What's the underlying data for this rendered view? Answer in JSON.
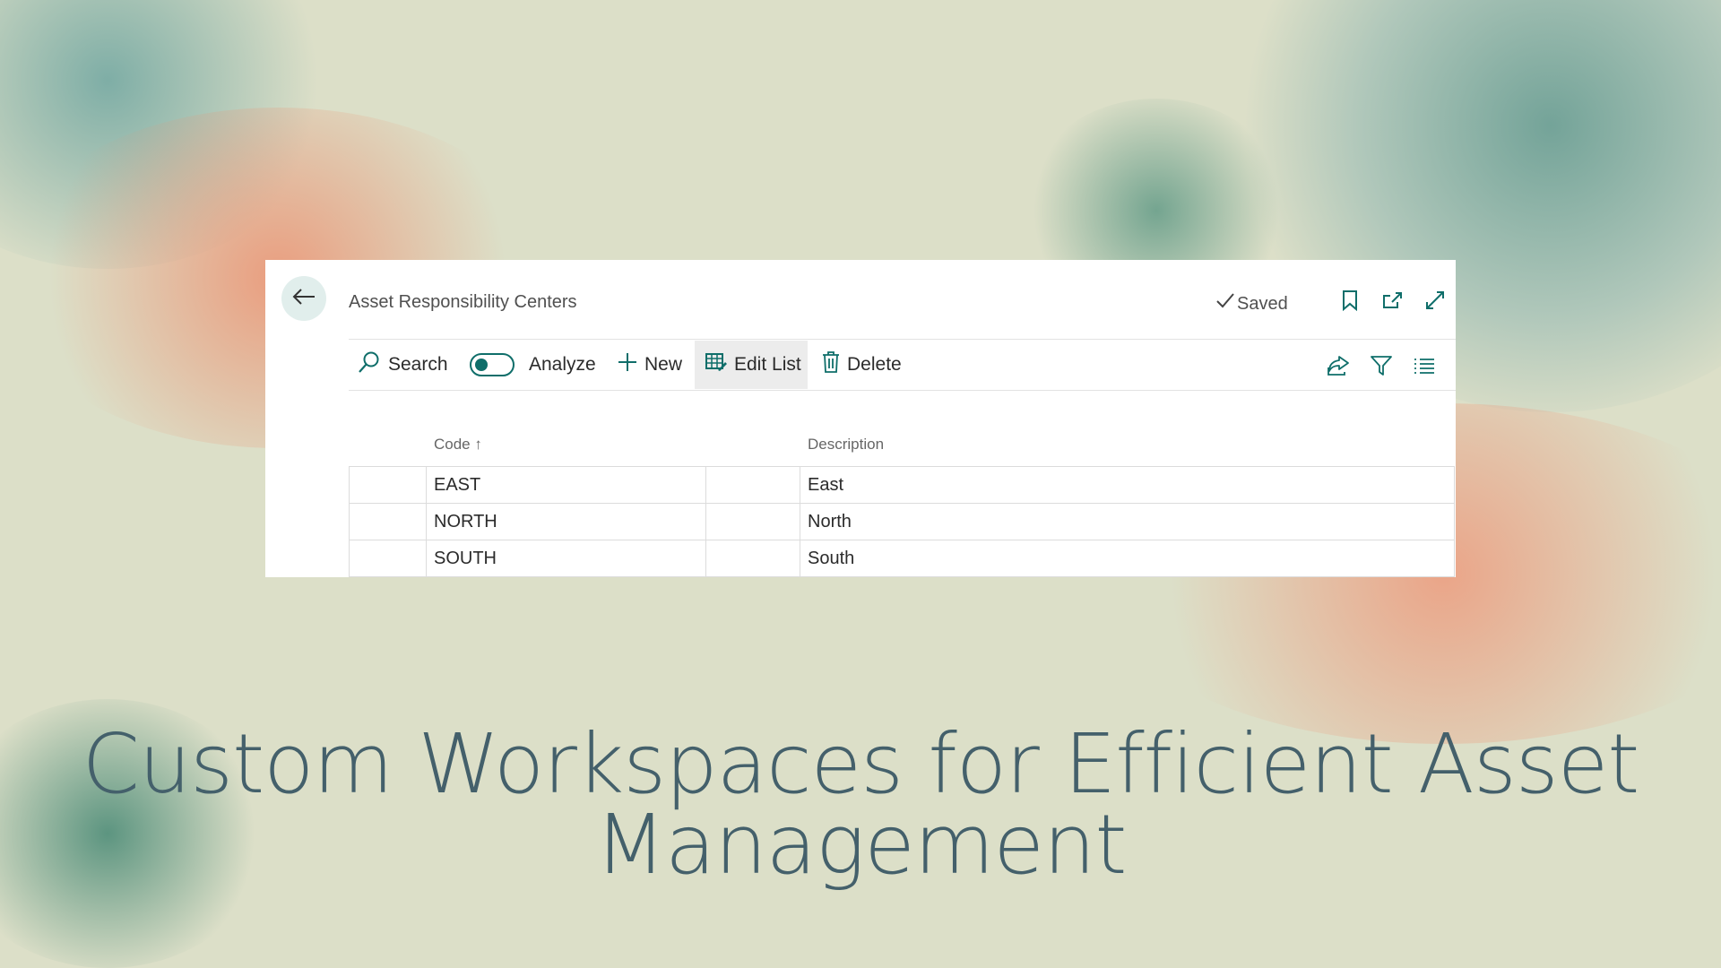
{
  "window": {
    "title": "Asset Responsibility Centers",
    "status": "Saved"
  },
  "toolbar": {
    "search_label": "Search",
    "analyze_label": "Analyze",
    "analyze_on": false,
    "new_label": "New",
    "edit_list_label": "Edit List",
    "delete_label": "Delete"
  },
  "table": {
    "columns": [
      "Code",
      "Description"
    ],
    "sort_indicator": "↑",
    "rows": [
      {
        "code": "EAST",
        "description": "East"
      },
      {
        "code": "NORTH",
        "description": "North"
      },
      {
        "code": "SOUTH",
        "description": "South"
      }
    ]
  },
  "banner": {
    "line1": "Custom Workspaces for Efficient Asset",
    "line2": "Management"
  },
  "icons": [
    "back-arrow-icon",
    "checkmark-icon",
    "bookmark-icon",
    "open-new-window-icon",
    "expand-icon",
    "search-icon",
    "plus-icon",
    "edit-list-icon",
    "delete-icon",
    "share-icon",
    "filter-icon",
    "list-view-icon"
  ],
  "colors": {
    "accent": "#0f6e6a",
    "title_text": "#44606b",
    "background": "#dcdfc8"
  }
}
